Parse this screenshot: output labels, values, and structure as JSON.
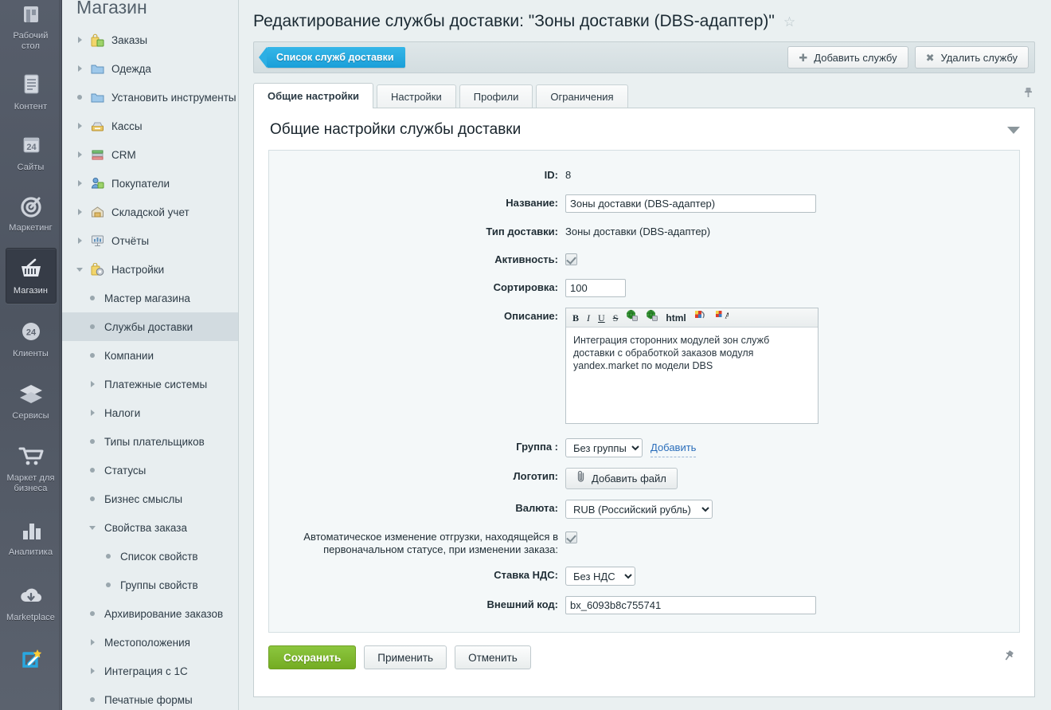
{
  "rail": {
    "items": [
      {
        "label": "Рабочий стол",
        "icon": "desk-icon",
        "active": false
      },
      {
        "label": "Контент",
        "icon": "document-icon",
        "active": false
      },
      {
        "label": "Сайты",
        "icon": "sites-24-icon",
        "active": false
      },
      {
        "label": "Маркетинг",
        "icon": "target-icon",
        "active": false
      },
      {
        "label": "Магазин",
        "icon": "basket-icon",
        "active": true
      },
      {
        "label": "Клиенты",
        "icon": "clients-24-icon",
        "active": false
      },
      {
        "label": "Сервисы",
        "icon": "layers-icon",
        "active": false
      },
      {
        "label": "Маркет для бизнеса",
        "icon": "cart-icon",
        "active": false
      },
      {
        "label": "Аналитика",
        "icon": "bar-chart-icon",
        "active": false
      },
      {
        "label": "Marketplace",
        "icon": "cloud-download-icon",
        "active": false
      },
      {
        "label": "",
        "icon": "site-edit-icon",
        "active": false
      }
    ]
  },
  "nav": {
    "title": "Магазин",
    "items": [
      {
        "label": "Заказы",
        "twisty": "right",
        "icon": "orders-icon",
        "level": 1,
        "selected": false
      },
      {
        "label": "Одежда",
        "twisty": "right",
        "icon": "folder-icon",
        "level": 1,
        "selected": false
      },
      {
        "label": "Установить инструменты и",
        "twisty": "bullet",
        "icon": "folder-icon",
        "level": 1,
        "selected": false
      },
      {
        "label": "Кассы",
        "twisty": "right",
        "icon": "cashbox-icon",
        "level": 1,
        "selected": false
      },
      {
        "label": "CRM",
        "twisty": "right",
        "icon": "crm-icon",
        "level": 1,
        "selected": false
      },
      {
        "label": "Покупатели",
        "twisty": "right",
        "icon": "buyers-icon",
        "level": 1,
        "selected": false
      },
      {
        "label": "Складской учет",
        "twisty": "right",
        "icon": "warehouse-icon",
        "level": 1,
        "selected": false
      },
      {
        "label": "Отчёты",
        "twisty": "right",
        "icon": "reports-icon",
        "level": 1,
        "selected": false
      },
      {
        "label": "Настройки",
        "twisty": "down",
        "icon": "settings-icon",
        "level": 1,
        "selected": false
      },
      {
        "label": "Мастер магазина",
        "twisty": "bullet",
        "icon": "",
        "level": 2,
        "selected": false
      },
      {
        "label": "Службы доставки",
        "twisty": "bullet",
        "icon": "",
        "level": 2,
        "selected": true
      },
      {
        "label": "Компании",
        "twisty": "bullet",
        "icon": "",
        "level": 2,
        "selected": false
      },
      {
        "label": "Платежные системы",
        "twisty": "right",
        "icon": "",
        "level": 2,
        "selected": false
      },
      {
        "label": "Налоги",
        "twisty": "right",
        "icon": "",
        "level": 2,
        "selected": false
      },
      {
        "label": "Типы плательщиков",
        "twisty": "bullet",
        "icon": "",
        "level": 2,
        "selected": false
      },
      {
        "label": "Статусы",
        "twisty": "bullet",
        "icon": "",
        "level": 2,
        "selected": false
      },
      {
        "label": "Бизнес смыслы",
        "twisty": "bullet",
        "icon": "",
        "level": 2,
        "selected": false
      },
      {
        "label": "Свойства заказа",
        "twisty": "down",
        "icon": "",
        "level": 2,
        "selected": false
      },
      {
        "label": "Список свойств",
        "twisty": "bullet",
        "icon": "",
        "level": 3,
        "selected": false
      },
      {
        "label": "Группы свойств",
        "twisty": "bullet",
        "icon": "",
        "level": 3,
        "selected": false
      },
      {
        "label": "Архивирование заказов",
        "twisty": "bullet",
        "icon": "",
        "level": 2,
        "selected": false
      },
      {
        "label": "Местоположения",
        "twisty": "right",
        "icon": "",
        "level": 2,
        "selected": false
      },
      {
        "label": "Интеграция с 1С",
        "twisty": "right",
        "icon": "",
        "level": 2,
        "selected": false
      },
      {
        "label": "Печатные формы",
        "twisty": "bullet",
        "icon": "",
        "level": 2,
        "selected": false
      }
    ]
  },
  "page": {
    "title": "Редактирование службы доставки: \"Зоны доставки (DBS-адаптер)\"",
    "favorite_icon": "star-icon"
  },
  "toolbar": {
    "back_label": "Список служб доставки",
    "add_label": "Добавить службу",
    "add_glyph": "✚",
    "delete_label": "Удалить службу",
    "delete_glyph": "✖"
  },
  "tabs": [
    {
      "label": "Общие настройки",
      "active": true
    },
    {
      "label": "Настройки",
      "active": false
    },
    {
      "label": "Профили",
      "active": false
    },
    {
      "label": "Ограничения",
      "active": false
    }
  ],
  "section": {
    "heading": "Общие настройки службы доставки",
    "collapse_icon": "chevron-down-icon"
  },
  "form": {
    "id_label": "ID:",
    "id_value": "8",
    "name_label": "Название:",
    "name_value": "Зоны доставки (DBS-адаптер)",
    "type_label": "Тип доставки:",
    "type_value": "Зоны доставки (DBS-адаптер)",
    "active_label": "Активность:",
    "active_checked": true,
    "sort_label": "Сортировка:",
    "sort_value": "100",
    "desc_label": "Описание:",
    "desc_value": "Интеграция сторонних модулей зон служб доставки с обработкой заказов модуля yandex.market по модели DBS",
    "editor_tools": [
      {
        "name": "bold-icon",
        "glyph": "B",
        "cls": "eb"
      },
      {
        "name": "italic-icon",
        "glyph": "I",
        "cls": "ei"
      },
      {
        "name": "underline-icon",
        "glyph": "U",
        "cls": "eu"
      },
      {
        "name": "strikethrough-icon",
        "glyph": "S",
        "cls": "es"
      },
      {
        "name": "insert-link-icon",
        "glyph": "",
        "cls": "globe"
      },
      {
        "name": "remove-link-icon",
        "glyph": "",
        "cls": "globe2"
      },
      {
        "name": "html-source-icon",
        "glyph": "html",
        "cls": "ehtml"
      },
      {
        "name": "background-color-icon",
        "glyph": "",
        "cls": "palette"
      },
      {
        "name": "font-color-icon",
        "glyph": "",
        "cls": "fontcolor"
      }
    ],
    "group_label": "Группа :",
    "group_value": "Без группы",
    "group_add_link": "Добавить",
    "logo_label": "Логотип:",
    "logo_btn": "Добавить файл",
    "logo_btn_icon": "paperclip-icon",
    "currency_label": "Валюта:",
    "currency_value": "RUB (Российский рубль)",
    "autoship_label": "Автоматическое изменение отгрузки, находящейся в первоначальном статусе, при изменении заказа:",
    "autoship_checked": true,
    "vat_label": "Ставка НДС:",
    "vat_value": "Без НДС",
    "extcode_label": "Внешний код:",
    "extcode_value": "bx_6093b8c755741"
  },
  "footer": {
    "save": "Сохранить",
    "apply": "Применить",
    "cancel": "Отменить",
    "pin_icon": "pin-icon"
  }
}
